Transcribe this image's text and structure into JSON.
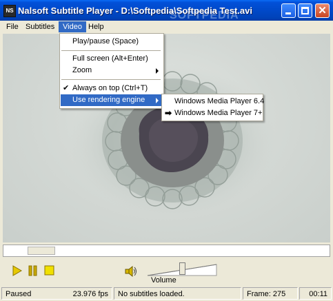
{
  "window": {
    "title": "Nalsoft Subtitle Player - D:\\Softpedia\\Softpedia Test.avi",
    "icon_text": "NS",
    "watermark": "SOFTPEDIA",
    "controls": {
      "minimize": "minimize-icon",
      "maximize": "maximize-icon",
      "close": "close-icon"
    },
    "close_glyph": "✕"
  },
  "menubar": {
    "items": [
      {
        "label": "File"
      },
      {
        "label": "Subtitles"
      },
      {
        "label": "Video"
      },
      {
        "label": "Help"
      }
    ],
    "active": "Video"
  },
  "video_menu": {
    "items": [
      {
        "label": "Play/pause (Space)"
      },
      {
        "label": "Full screen (Alt+Enter)"
      },
      {
        "label": "Zoom",
        "submenu": true
      },
      {
        "label": "Always on top (Ctrl+T)",
        "checked": true,
        "check_glyph": "✔"
      },
      {
        "label": "Use rendering engine",
        "submenu": true,
        "highlighted": true
      }
    ]
  },
  "rendering_submenu": {
    "items": [
      {
        "label": "Windows Media Player 6.4",
        "selected": false
      },
      {
        "label": "Windows Media Player 7+",
        "selected": true,
        "mark_glyph": "➡"
      }
    ]
  },
  "seek": {
    "position_fraction": 0.08
  },
  "controls": {
    "buttons": [
      "play-icon",
      "pause-icon",
      "stop-icon"
    ],
    "volume_label": "Volume",
    "volume_level": 0.5
  },
  "status": {
    "state": "Paused",
    "fps": "23.976 fps",
    "subtitles": "No subtitles loaded.",
    "frame": "Frame: 275",
    "time": "00:11"
  },
  "colors": {
    "titlebar": "#0049c9",
    "menu_highlight": "#316ac5",
    "play": "#e6c800",
    "pause": "#c8a800",
    "stop": "#f0e000"
  }
}
